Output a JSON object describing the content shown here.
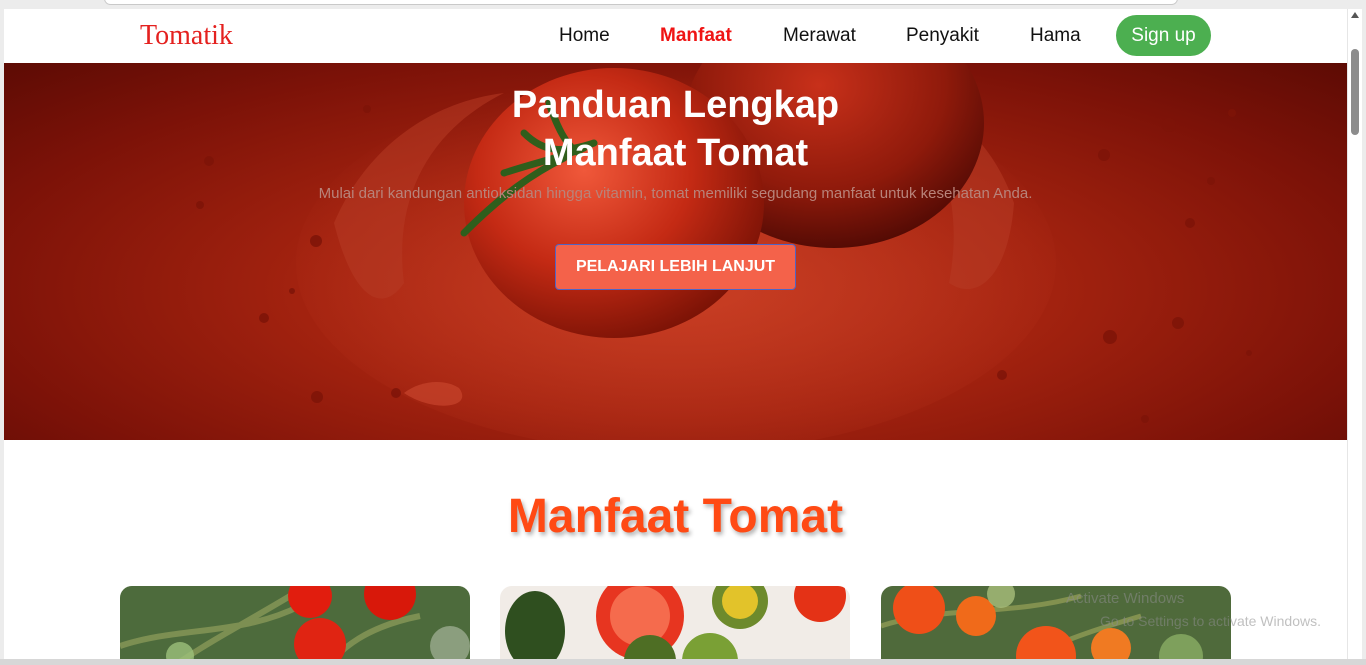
{
  "brand": {
    "logo": "Tomatik"
  },
  "nav": {
    "items": [
      {
        "label": "Home",
        "active": false
      },
      {
        "label": "Manfaat",
        "active": true
      },
      {
        "label": "Merawat",
        "active": false
      },
      {
        "label": "Penyakit",
        "active": false
      },
      {
        "label": "Hama",
        "active": false
      }
    ],
    "signup_label": "Sign up"
  },
  "hero": {
    "title_line1": "Panduan Lengkap",
    "title_line2": "Manfaat Tomat",
    "subtitle": "Mulai dari kandungan antioksidan hingga vitamin, tomat memiliki segudang manfaat untuk kesehatan Anda.",
    "cta_label": "PELAJARI LEBIH LANJUT",
    "image": "tomato-juice-splash"
  },
  "benefits": {
    "title": "Manfaat Tomat",
    "cards": [
      {
        "image": "tomato-plant-photo"
      },
      {
        "image": "sliced-tomatoes-photo"
      },
      {
        "image": "tomato-garden-photo"
      }
    ]
  },
  "watermark": {
    "line1": "Activate Windows",
    "line2": "Go to Settings to activate Windows."
  },
  "colors": {
    "brand_red": "#e4211f",
    "active_nav": "#ef1414",
    "signup_green": "#4caf50",
    "cta_orange": "#f4624a",
    "section_title": "#ff4a14"
  }
}
